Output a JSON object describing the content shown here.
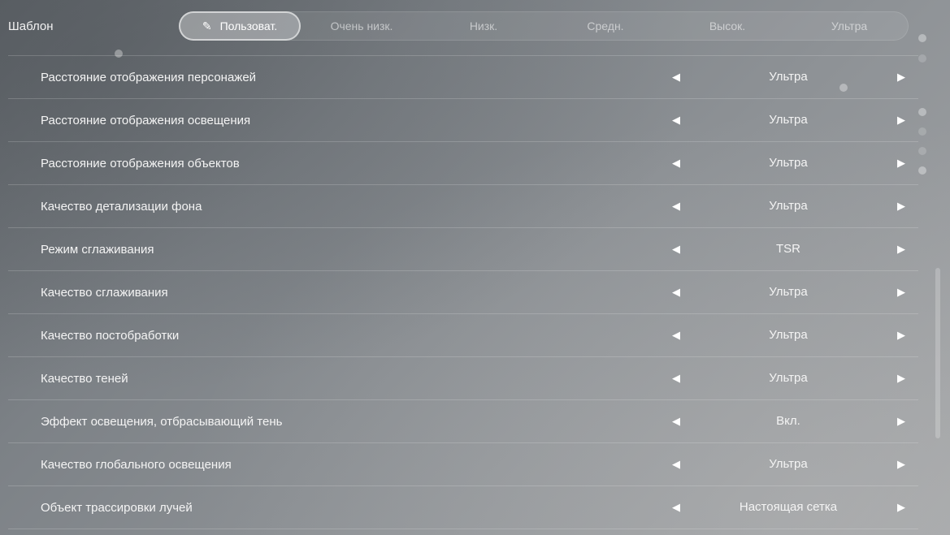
{
  "preset": {
    "label": "Шаблон",
    "options": [
      {
        "label": "Пользоват.",
        "active": true,
        "icon": "pencil-icon"
      },
      {
        "label": "Очень низк.",
        "active": false
      },
      {
        "label": "Низк.",
        "active": false
      },
      {
        "label": "Средн.",
        "active": false
      },
      {
        "label": "Высок.",
        "active": false
      },
      {
        "label": "Ультра",
        "active": false
      }
    ]
  },
  "settings": [
    {
      "name": "Расстояние отображения персонажей",
      "value": "Ультра"
    },
    {
      "name": "Расстояние отображения освещения",
      "value": "Ультра"
    },
    {
      "name": "Расстояние отображения объектов",
      "value": "Ультра"
    },
    {
      "name": "Качество детализации фона",
      "value": "Ультра"
    },
    {
      "name": "Режим сглаживания",
      "value": "TSR"
    },
    {
      "name": "Качество сглаживания",
      "value": "Ультра"
    },
    {
      "name": "Качество постобработки",
      "value": "Ультра"
    },
    {
      "name": "Качество теней",
      "value": "Ультра"
    },
    {
      "name": "Эффект освещения, отбрасывающий тень",
      "value": "Вкл."
    },
    {
      "name": "Качество глобального освещения",
      "value": "Ультра"
    },
    {
      "name": "Объект трассировки лучей",
      "value": "Настоящая сетка"
    }
  ],
  "icons": {
    "left_arrow": "◀",
    "right_arrow": "▶",
    "pencil": "✎"
  }
}
